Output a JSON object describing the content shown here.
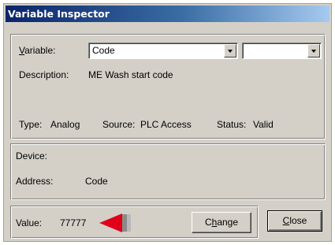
{
  "window": {
    "title": "Variable Inspector"
  },
  "variable": {
    "label_mnemonic": "V",
    "label_rest": "ariable:",
    "selected": "Code",
    "secondary_selected": ""
  },
  "description": {
    "label": "Description:",
    "value": "ME Wash start code"
  },
  "info": {
    "type_label": "Type:",
    "type_value": "Analog",
    "source_label": "Source:",
    "source_value": "PLC Access",
    "status_label": "Status:",
    "status_value": "Valid"
  },
  "device": {
    "label": "Device:",
    "address_label": "Address:",
    "address_value": "Code"
  },
  "value": {
    "label": "Value:",
    "number": "77777"
  },
  "buttons": {
    "change_mnemonic": "h",
    "change_pre": "C",
    "change_post": "ange",
    "close_mnemonic": "C",
    "close_rest": "lose"
  },
  "colors": {
    "dialog_face": "#d4d0c8",
    "title_gradient_start": "#0a246a",
    "title_gradient_end": "#a6caf0",
    "annotation_arrow": "#e0001a"
  },
  "icons": {
    "annotation": "red-arrow-pointer-icon",
    "dropdown": "chevron-down-icon"
  }
}
